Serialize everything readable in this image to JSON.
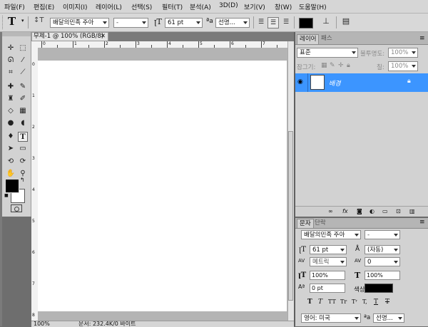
{
  "menu": [
    "파일(F)",
    "편집(E)",
    "이미지(I)",
    "레이어(L)",
    "선택(S)",
    "필터(T)",
    "분석(A)",
    "3D(D)",
    "보기(V)",
    "창(W)",
    "도움말(H)"
  ],
  "options": {
    "tool_glyph": "T",
    "font_family": "배달의민족 주아",
    "font_style": "-",
    "font_size": "61 pt",
    "aa_label": "ªa",
    "aa_mode": "선명..."
  },
  "document": {
    "tab_title": "무제-1 @ 100% (RGB/8)",
    "ruler_top": [
      "0",
      "1",
      "2",
      "3",
      "4",
      "5",
      "6",
      "7",
      "8"
    ],
    "ruler_left": [
      "0",
      "1",
      "2",
      "3",
      "4",
      "5",
      "6",
      "7",
      "8",
      "9"
    ],
    "status_zoom": "100%",
    "status_text": "문서: 232.4K/0 바이트"
  },
  "layers": {
    "tab_active": "레이어",
    "tab_inactive": "패스",
    "blend_mode": "표준",
    "opacity_label": "불투명도:",
    "opacity_value": "100%",
    "lock_label": "잠그기:",
    "fill_label": "칠:",
    "fill_value": "100%",
    "layer_name": "배경"
  },
  "character": {
    "tab_active": "문자",
    "tab_inactive": "단락",
    "font_family": "배달의민족 주아",
    "font_style": "-",
    "size": "61 pt",
    "leading": "(자동)",
    "kerning": "메트릭",
    "tracking": "0",
    "vscale": "100%",
    "hscale": "100%",
    "baseline": "0 pt",
    "color_label": "색상:",
    "language": "영어: 미국",
    "aa_label": "ªa",
    "aa_mode": "선명..."
  },
  "colors": {
    "accent": "#3c95ff",
    "foreground": "#000000",
    "background": "#ffffff"
  }
}
